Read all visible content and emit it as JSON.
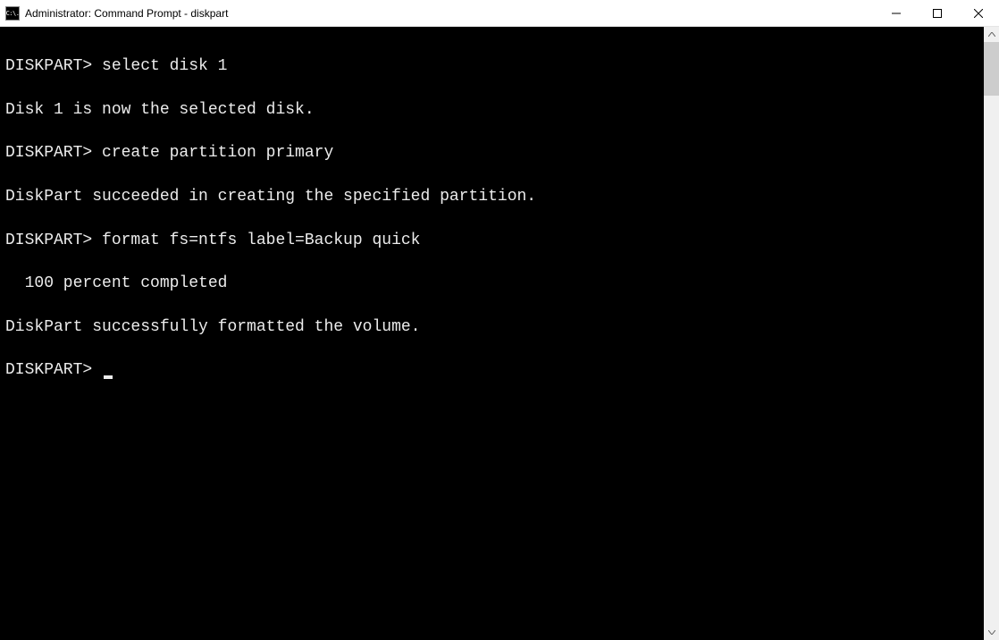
{
  "window": {
    "icon_text": "C:\\.",
    "title": "Administrator: Command Prompt - diskpart"
  },
  "terminal": {
    "lines": [
      "",
      "DISKPART> select disk 1",
      "",
      "Disk 1 is now the selected disk.",
      "",
      "DISKPART> create partition primary",
      "",
      "DiskPart succeeded in creating the specified partition.",
      "",
      "DISKPART> format fs=ntfs label=Backup quick",
      "",
      "  100 percent completed",
      "",
      "DiskPart successfully formatted the volume.",
      "",
      "DISKPART> "
    ],
    "cursor_after_last": true
  }
}
